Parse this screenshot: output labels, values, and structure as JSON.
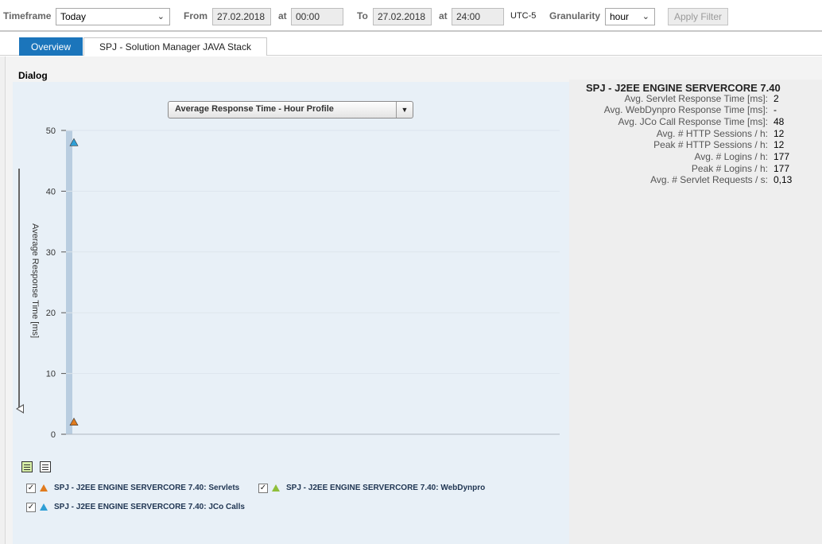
{
  "filter": {
    "timeframe_label": "Timeframe",
    "timeframe_value": "Today",
    "from_label": "From",
    "from_date": "27.02.2018",
    "from_at_label": "at",
    "from_time": "00:00",
    "to_label": "To",
    "to_date": "27.02.2018",
    "to_at_label": "at",
    "to_time": "24:00",
    "timezone": "UTC-5",
    "granularity_label": "Granularity",
    "granularity_value": "hour",
    "apply_label": "Apply Filter"
  },
  "tabs": [
    {
      "label": "Overview",
      "active": true
    },
    {
      "label": "SPJ - Solution Manager JAVA Stack",
      "active": false
    }
  ],
  "section_title": "Dialog",
  "chart_data": {
    "type": "scatter",
    "title": "Average Response Time - Hour Profile",
    "ylabel": "Average Response Time [ms]",
    "ylim": [
      0,
      50
    ],
    "yticks": [
      0,
      10,
      20,
      30,
      40,
      50
    ],
    "grid": true,
    "series": [
      {
        "name": "SPJ - J2EE ENGINE SERVERCORE 7.40: Servlets",
        "color": "#e07b1e",
        "values": [
          2
        ]
      },
      {
        "name": "SPJ - J2EE ENGINE SERVERCORE 7.40: WebDynpro",
        "color": "#8fbf3a",
        "values": []
      },
      {
        "name": "SPJ - J2EE ENGINE SERVERCORE 7.40: JCo Calls",
        "color": "#2f9fd6",
        "values": [
          48
        ]
      }
    ]
  },
  "legend": [
    {
      "label": "SPJ - J2EE ENGINE SERVERCORE 7.40: Servlets",
      "color": "#e07b1e",
      "checked": "✓"
    },
    {
      "label": "SPJ - J2EE ENGINE SERVERCORE 7.40: WebDynpro",
      "color": "#8fbf3a",
      "checked": "✓"
    },
    {
      "label": "SPJ - J2EE ENGINE SERVERCORE 7.40: JCo Calls",
      "color": "#2f9fd6",
      "checked": "✓"
    }
  ],
  "metrics": {
    "title": "SPJ - J2EE ENGINE SERVERCORE 7.40",
    "rows": [
      {
        "label": "Avg. Servlet Response Time [ms]:",
        "value": "2"
      },
      {
        "label": "Avg. WebDynpro Response Time [ms]:",
        "value": "-"
      },
      {
        "label": "Avg. JCo Call Response Time [ms]:",
        "value": "48"
      },
      {
        "label": "Avg. # HTTP Sessions / h:",
        "value": "12"
      },
      {
        "label": "Peak # HTTP Sessions / h:",
        "value": "12"
      },
      {
        "label": "Avg. # Logins / h:",
        "value": "177"
      },
      {
        "label": "Peak # Logins / h:",
        "value": "177"
      },
      {
        "label": "Avg. # Servlet Requests / s:",
        "value": "0,13"
      }
    ]
  }
}
